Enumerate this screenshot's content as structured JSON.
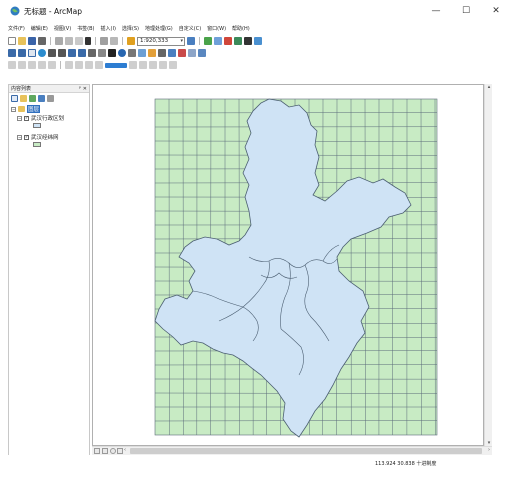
{
  "window": {
    "title": "无标题 - ArcMap",
    "minimize": "—",
    "maximize": "☐",
    "close": "✕"
  },
  "menu": [
    "文件(F)",
    "编辑(E)",
    "视图(V)",
    "书签(B)",
    "插入(I)",
    "选择(S)",
    "地理处理(G)",
    "自定义(C)",
    "窗口(W)",
    "帮助(H)"
  ],
  "toolbar": {
    "scale_value": "1:920,333"
  },
  "toc": {
    "header": "内容列表",
    "pin": "ᵖ",
    "close": "✕",
    "layers_root": "图层",
    "layers": [
      {
        "name": "武汉行政区划",
        "checked": true,
        "color": "#cfe3f5"
      },
      {
        "name": "武汉经纬网",
        "checked": true,
        "color": "#c8ebc4"
      }
    ]
  },
  "statusbar": {
    "coords": "113.924  30.838 十进制度"
  },
  "colors": {
    "grid_fill": "#c8ebc4",
    "region_fill": "#cfe3f5",
    "line": "#5b6b7a"
  },
  "icons": {
    "app": "globe-icon",
    "scroll_up": "▴",
    "scroll_down": "▾",
    "scroll_left": "‹",
    "scroll_right": "›"
  }
}
